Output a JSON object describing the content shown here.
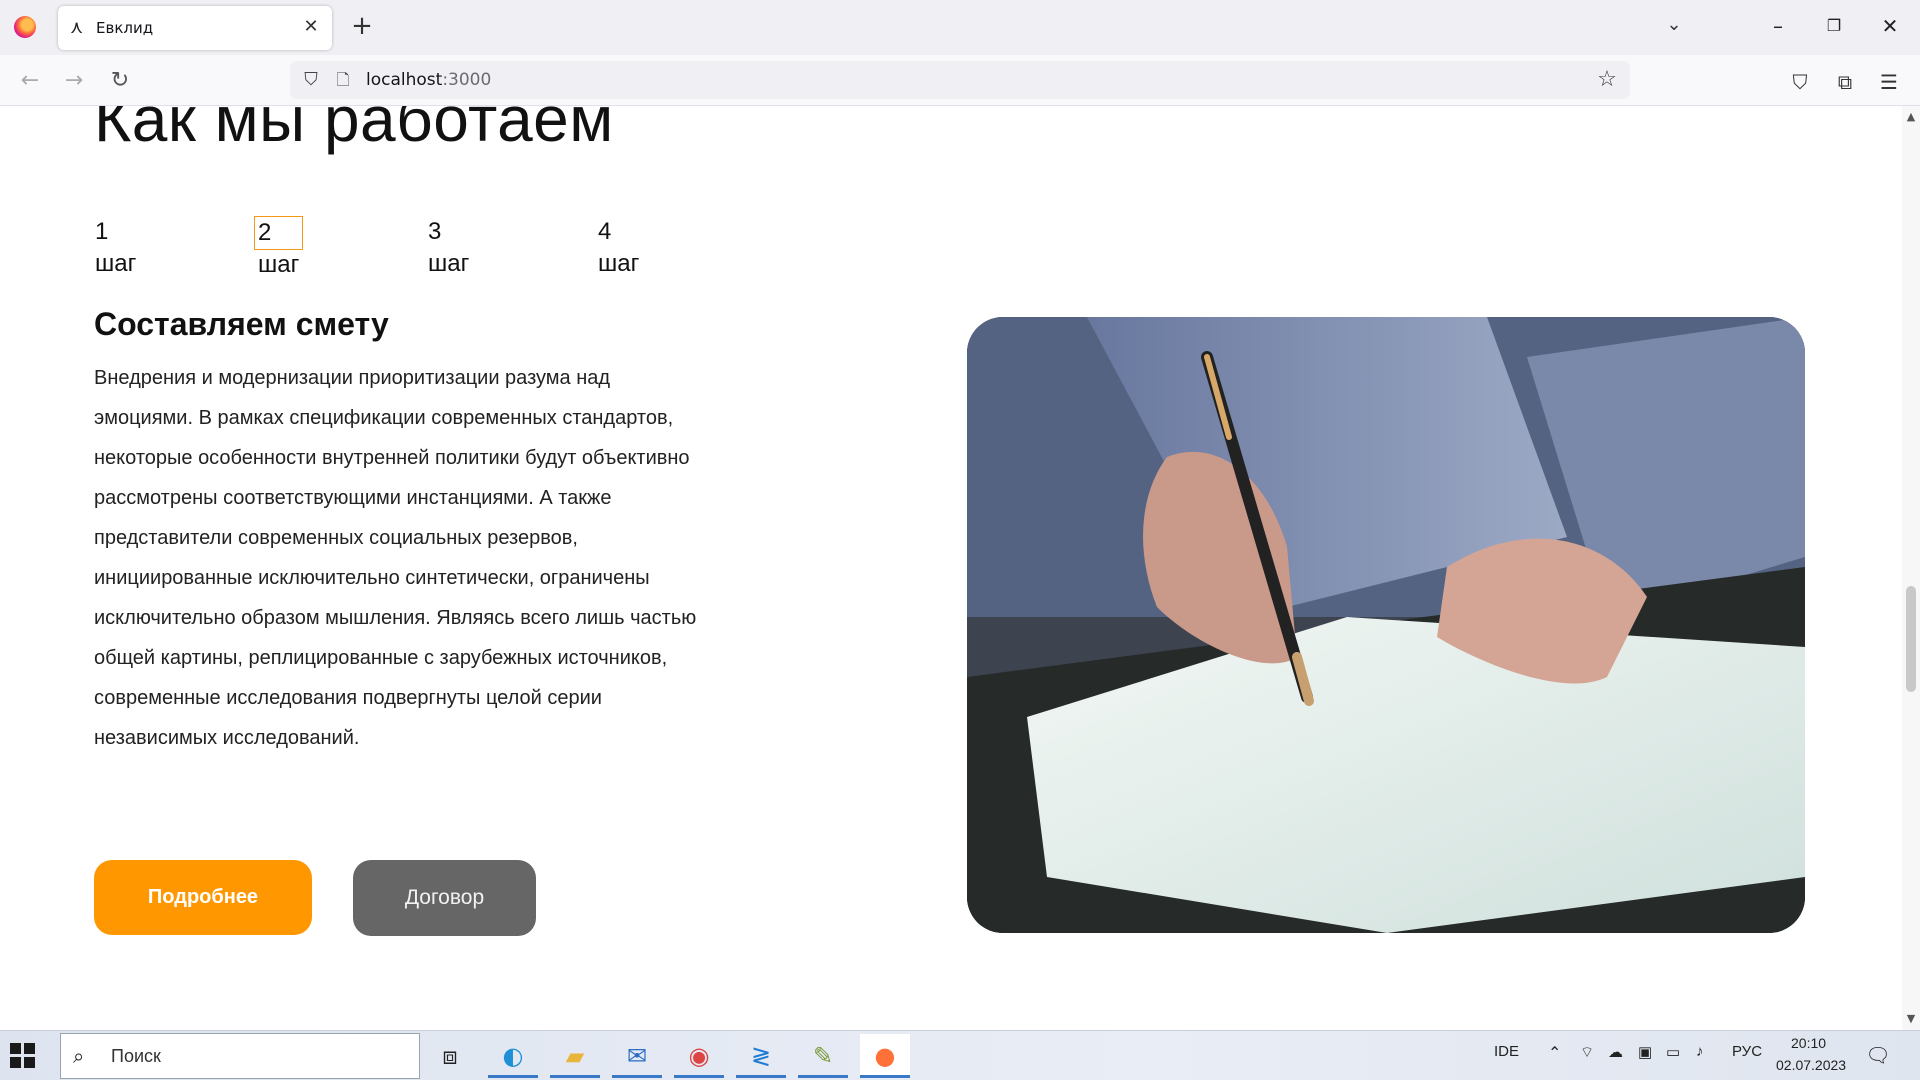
{
  "browser": {
    "tab_title": "Евклид",
    "url_host": "localhost",
    "url_port": ":3000"
  },
  "page": {
    "section_title": "Как мы работаем",
    "steps": [
      "1 шаг",
      "2 шаг",
      "3 шаг",
      "4 шаг"
    ],
    "active_step_index": 1,
    "content_title": "Составляем смету",
    "content_text": "Внедрения и модернизации приоритизации разума над эмоциями. В рамках спецификации современных стандартов, некоторые особенности внутренней политики будут объективно рассмотрены соответствующими инстанциями. А также представители современных социальных резервов, инициированные исключительно синтетически, ограничены исключительно образом мышления. Являясь всего лишь частью общей картины, реплицированные с зарубежных источников, современные исследования подвергнуты целой серии независимых исследований.",
    "more_button": "Подробнее",
    "contract_button": "Договор",
    "accent_color": "#ff9800",
    "secondary_color": "#666666"
  },
  "taskbar": {
    "search_placeholder": "Поиск",
    "ide_label": "IDE",
    "language": "РУС",
    "time": "20:10",
    "date": "02.07.2023"
  }
}
